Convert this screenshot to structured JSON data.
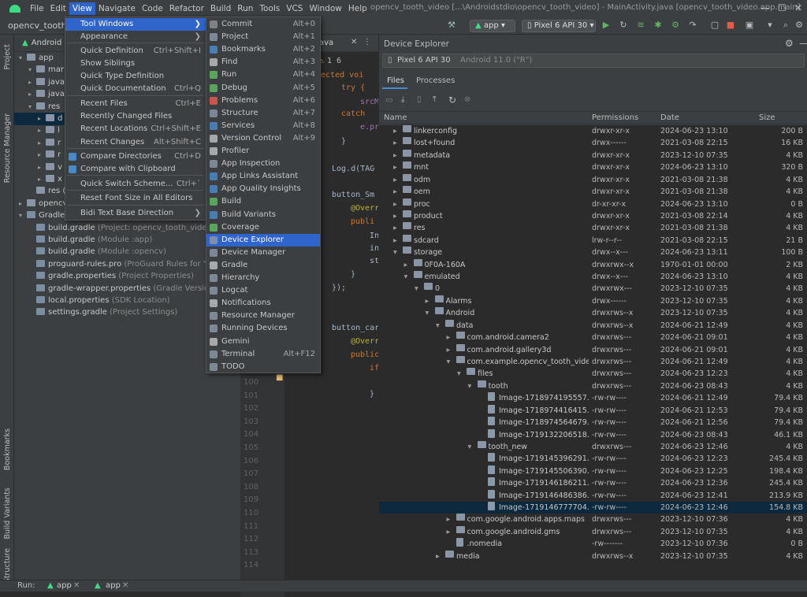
{
  "menubar": {
    "items": [
      "File",
      "Edit",
      "View",
      "Navigate",
      "Code",
      "Refactor",
      "Build",
      "Run",
      "Tools",
      "VCS",
      "Window",
      "Help"
    ],
    "active": "View",
    "window_title": "opencv_tooth_video [...\\Androidstdio\\opencv_tooth_video] - MainActivity.java [opencv_tooth_video.app.main]"
  },
  "toolbar": {
    "project_name": "opencv_tooth_v",
    "run_config": "app",
    "device": "Pixel 6 API 30"
  },
  "left_tool_windows": [
    "Project",
    "Resource Manager",
    "Bookmarks",
    "Build Variants",
    "Structure"
  ],
  "project_pane": {
    "header": "Android",
    "tree": [
      {
        "label": "app",
        "dim": ""
      },
      {
        "label": "mar",
        "dim": ""
      },
      {
        "label": "java",
        "dim": ""
      },
      {
        "label": "java",
        "dim": ""
      },
      {
        "label": "res",
        "dim": ""
      },
      {
        "label": "d",
        "dim": ""
      },
      {
        "label": "l",
        "dim": ""
      },
      {
        "label": "r",
        "dim": ""
      },
      {
        "label": "r",
        "dim": ""
      },
      {
        "label": "v",
        "dim": ""
      },
      {
        "label": "x",
        "dim": ""
      },
      {
        "label": "res (",
        "dim": ""
      },
      {
        "label": "opencv",
        "dim": ""
      },
      {
        "label": "Gradle Scripts",
        "dim": ""
      },
      {
        "label": "build.gradle",
        "dim": "(Project: opencv_tooth_video)"
      },
      {
        "label": "build.gradle",
        "dim": "(Module :app)"
      },
      {
        "label": "build.gradle",
        "dim": "(Module :opencv)"
      },
      {
        "label": "proguard-rules.pro",
        "dim": "(ProGuard Rules for \":app"
      },
      {
        "label": "gradle.properties",
        "dim": "(Project Properties)"
      },
      {
        "label": "gradle-wrapper.properties",
        "dim": "(Gradle Version)"
      },
      {
        "label": "local.properties",
        "dim": "(SDK Location)"
      },
      {
        "label": "settings.gradle",
        "dim": "(Project Settings)"
      }
    ]
  },
  "editor": {
    "tab": "ava",
    "inspections": "1  6",
    "line_numbers": [
      "100",
      "101",
      "102",
      "103",
      "104",
      "105",
      "106",
      "107",
      "108",
      "109",
      "110",
      "111",
      "112",
      "113",
      "114"
    ],
    "code_lines": [
      "otected voi",
      "try {",
      "srcM",
      "catch",
      "e.pr",
      "}",
      "Log.d(TAG",
      "button_Sm",
      "@Overr",
      "publi",
      "In",
      "in",
      "st",
      "}",
      "});",
      "button_car",
      "@Overr",
      "public",
      "if",
      "}"
    ]
  },
  "view_menu": [
    {
      "label": "Tool Windows",
      "shortcut": "",
      "submenu": true
    },
    {
      "label": "Appearance",
      "shortcut": "",
      "submenu": true
    },
    {
      "label": "Quick Definition",
      "shortcut": "Ctrl+Shift+I"
    },
    {
      "label": "Show Siblings",
      "shortcut": ""
    },
    {
      "label": "Quick Type Definition",
      "shortcut": ""
    },
    {
      "label": "Quick Documentation",
      "shortcut": "Ctrl+Q"
    },
    {
      "label": "Recent Files",
      "shortcut": "Ctrl+E"
    },
    {
      "label": "Recently Changed Files",
      "shortcut": ""
    },
    {
      "label": "Recent Locations",
      "shortcut": "Ctrl+Shift+E"
    },
    {
      "label": "Recent Changes",
      "shortcut": "Alt+Shift+C"
    },
    {
      "label": "Compare Directories",
      "shortcut": "Ctrl+D"
    },
    {
      "label": "Compare with Clipboard",
      "shortcut": ""
    },
    {
      "label": "Quick Switch Scheme...",
      "shortcut": "Ctrl+`"
    },
    {
      "label": "Reset Font Size in All Editors",
      "shortcut": ""
    },
    {
      "label": "Bidi Text Base Direction",
      "shortcut": "",
      "submenu": true
    }
  ],
  "tool_windows_menu": [
    {
      "label": "Commit",
      "shortcut": "Alt+0"
    },
    {
      "label": "Project",
      "shortcut": "Alt+1"
    },
    {
      "label": "Bookmarks",
      "shortcut": "Alt+2"
    },
    {
      "label": "Find",
      "shortcut": "Alt+3"
    },
    {
      "label": "Run",
      "shortcut": "Alt+4"
    },
    {
      "label": "Debug",
      "shortcut": "Alt+5"
    },
    {
      "label": "Problems",
      "shortcut": "Alt+6"
    },
    {
      "label": "Structure",
      "shortcut": "Alt+7"
    },
    {
      "label": "Services",
      "shortcut": "Alt+8"
    },
    {
      "label": "Version Control",
      "shortcut": "Alt+9"
    },
    {
      "label": "Profiler",
      "shortcut": ""
    },
    {
      "label": "App Inspection",
      "shortcut": ""
    },
    {
      "label": "App Links Assistant",
      "shortcut": ""
    },
    {
      "label": "App Quality Insights",
      "shortcut": ""
    },
    {
      "label": "Build",
      "shortcut": ""
    },
    {
      "label": "Build Variants",
      "shortcut": ""
    },
    {
      "label": "Coverage",
      "shortcut": ""
    },
    {
      "label": "Device Explorer",
      "shortcut": ""
    },
    {
      "label": "Device Manager",
      "shortcut": ""
    },
    {
      "label": "Gradle",
      "shortcut": ""
    },
    {
      "label": "Hierarchy",
      "shortcut": ""
    },
    {
      "label": "Logcat",
      "shortcut": ""
    },
    {
      "label": "Notifications",
      "shortcut": ""
    },
    {
      "label": "Resource Manager",
      "shortcut": ""
    },
    {
      "label": "Running Devices",
      "shortcut": ""
    },
    {
      "label": "Gemini",
      "shortcut": ""
    },
    {
      "label": "Terminal",
      "shortcut": "Alt+F12"
    },
    {
      "label": "TODO",
      "shortcut": ""
    }
  ],
  "device_explorer": {
    "title": "Device Explorer",
    "device": "Pixel 6 API 30",
    "device_detail": "Android 11.0 (\"R\")",
    "tabs": [
      "Files",
      "Processes"
    ],
    "columns": [
      "Name",
      "Permissions",
      "Date",
      "Size"
    ],
    "rows": [
      {
        "name": "linkerconfig",
        "perm": "drwxr-xr-x",
        "date": "2024-06-23 13:10",
        "size": "200 B",
        "depth": 0,
        "type": "folder",
        "exp": "closed"
      },
      {
        "name": "lost+found",
        "perm": "drwx------",
        "date": "2021-03-08 22:15",
        "size": "16 KB",
        "depth": 0,
        "type": "folder",
        "exp": "closed"
      },
      {
        "name": "metadata",
        "perm": "drwxr-xr-x",
        "date": "2023-12-10 07:35",
        "size": "4 KB",
        "depth": 0,
        "type": "folder",
        "exp": "closed"
      },
      {
        "name": "mnt",
        "perm": "drwxr-xr-x",
        "date": "2024-06-23 13:10",
        "size": "320 B",
        "depth": 0,
        "type": "folder",
        "exp": "closed"
      },
      {
        "name": "odm",
        "perm": "drwxr-xr-x",
        "date": "2021-03-08 21:38",
        "size": "4 KB",
        "depth": 0,
        "type": "folder",
        "exp": "closed"
      },
      {
        "name": "oem",
        "perm": "drwxr-xr-x",
        "date": "2021-03-08 21:38",
        "size": "4 KB",
        "depth": 0,
        "type": "folder",
        "exp": "closed"
      },
      {
        "name": "proc",
        "perm": "dr-xr-xr-x",
        "date": "2024-06-23 13:10",
        "size": "0 B",
        "depth": 0,
        "type": "folder",
        "exp": "closed"
      },
      {
        "name": "product",
        "perm": "drwxr-xr-x",
        "date": "2021-03-08 22:14",
        "size": "4 KB",
        "depth": 0,
        "type": "folder",
        "exp": "closed"
      },
      {
        "name": "res",
        "perm": "drwxr-xr-x",
        "date": "2021-03-08 21:38",
        "size": "4 KB",
        "depth": 0,
        "type": "folder",
        "exp": "closed"
      },
      {
        "name": "sdcard",
        "perm": "lrw-r--r--",
        "date": "2021-03-08 22:15",
        "size": "21 B",
        "depth": 0,
        "type": "folder",
        "exp": "closed"
      },
      {
        "name": "storage",
        "perm": "drwx--x---",
        "date": "2024-06-23 13:11",
        "size": "100 B",
        "depth": 0,
        "type": "folder",
        "exp": "open"
      },
      {
        "name": "0F0A-160A",
        "perm": "drwxrwx--x",
        "date": "1970-01-01 00:00",
        "size": "2 KB",
        "depth": 1,
        "type": "folder",
        "exp": "closed"
      },
      {
        "name": "emulated",
        "perm": "drwx--x---",
        "date": "2024-06-23 13:10",
        "size": "4 KB",
        "depth": 1,
        "type": "folder",
        "exp": "open"
      },
      {
        "name": "0",
        "perm": "drwxrwx---",
        "date": "2023-12-10 07:35",
        "size": "4 KB",
        "depth": 2,
        "type": "folder",
        "exp": "open"
      },
      {
        "name": "Alarms",
        "perm": "drwx------",
        "date": "2023-12-10 07:35",
        "size": "4 KB",
        "depth": 3,
        "type": "folder",
        "exp": "closed"
      },
      {
        "name": "Android",
        "perm": "drwxrws--x",
        "date": "2023-12-10 07:35",
        "size": "4 KB",
        "depth": 3,
        "type": "folder",
        "exp": "open"
      },
      {
        "name": "data",
        "perm": "drwxrws--x",
        "date": "2024-06-21 12:49",
        "size": "4 KB",
        "depth": 4,
        "type": "folder",
        "exp": "open"
      },
      {
        "name": "com.android.camera2",
        "perm": "drwxrws---",
        "date": "2024-06-21 09:01",
        "size": "4 KB",
        "depth": 5,
        "type": "folder",
        "exp": "closed"
      },
      {
        "name": "com.android.gallery3d",
        "perm": "drwxrws---",
        "date": "2024-06-21 09:01",
        "size": "4 KB",
        "depth": 5,
        "type": "folder",
        "exp": "closed"
      },
      {
        "name": "com.example.opencv_tooth_vide",
        "perm": "drwxrws---",
        "date": "2024-06-21 12:49",
        "size": "4 KB",
        "depth": 5,
        "type": "folder",
        "exp": "open"
      },
      {
        "name": "files",
        "perm": "drwxrws---",
        "date": "2024-06-23 12:23",
        "size": "4 KB",
        "depth": 6,
        "type": "folder",
        "exp": "open"
      },
      {
        "name": "tooth",
        "perm": "drwxrws---",
        "date": "2024-06-23 08:43",
        "size": "4 KB",
        "depth": 7,
        "type": "folder",
        "exp": "open"
      },
      {
        "name": "Image-1718974195557.j",
        "perm": "-rw-rw----",
        "date": "2024-06-21 12:49",
        "size": "79.4 KB",
        "depth": 8,
        "type": "file",
        "exp": "none"
      },
      {
        "name": "Image-1718974416415.j",
        "perm": "-rw-rw----",
        "date": "2024-06-21 12:53",
        "size": "79.4 KB",
        "depth": 8,
        "type": "file",
        "exp": "none"
      },
      {
        "name": "Image-1718974564679.j",
        "perm": "-rw-rw----",
        "date": "2024-06-21 12:56",
        "size": "79.4 KB",
        "depth": 8,
        "type": "file",
        "exp": "none"
      },
      {
        "name": "Image-1719132206518.j",
        "perm": "-rw-rw----",
        "date": "2024-06-23 08:43",
        "size": "46.1 KB",
        "depth": 8,
        "type": "file",
        "exp": "none"
      },
      {
        "name": "tooth_new",
        "perm": "drwxrws---",
        "date": "2024-06-23 12:46",
        "size": "4 KB",
        "depth": 7,
        "type": "folder",
        "exp": "open"
      },
      {
        "name": "Image-1719145396291.j",
        "perm": "-rw-rw----",
        "date": "2024-06-23 12:23",
        "size": "245.4 KB",
        "depth": 8,
        "type": "file",
        "exp": "none"
      },
      {
        "name": "Image-1719145506390.j",
        "perm": "-rw-rw----",
        "date": "2024-06-23 12:25",
        "size": "198.4 KB",
        "depth": 8,
        "type": "file",
        "exp": "none"
      },
      {
        "name": "Image-1719146186211.j",
        "perm": "-rw-rw----",
        "date": "2024-06-23 12:36",
        "size": "245.4 KB",
        "depth": 8,
        "type": "file",
        "exp": "none"
      },
      {
        "name": "Image-1719146486386.j",
        "perm": "-rw-rw----",
        "date": "2024-06-23 12:41",
        "size": "213.9 KB",
        "depth": 8,
        "type": "file",
        "exp": "none"
      },
      {
        "name": "Image-1719146777704.j",
        "perm": "-rw-rw----",
        "date": "2024-06-23 12:46",
        "size": "154.8 KB",
        "depth": 8,
        "type": "file",
        "exp": "none",
        "selected": true
      },
      {
        "name": "com.google.android.apps.maps",
        "perm": "drwxrws---",
        "date": "2023-12-10 07:36",
        "size": "4 KB",
        "depth": 5,
        "type": "folder",
        "exp": "closed"
      },
      {
        "name": "com.google.android.gms",
        "perm": "drwxrws---",
        "date": "2023-12-10 07:35",
        "size": "4 KB",
        "depth": 5,
        "type": "folder",
        "exp": "closed"
      },
      {
        "name": ".nomedia",
        "perm": "-rw-------",
        "date": "2023-12-10 07:36",
        "size": "0 B",
        "depth": 5,
        "type": "file",
        "exp": "none"
      },
      {
        "name": "media",
        "perm": "drwxrws--x",
        "date": "2023-12-10 07:35",
        "size": "4 KB",
        "depth": 4,
        "type": "folder",
        "exp": "closed"
      }
    ]
  },
  "bottom_bar": {
    "run_label": "Run:",
    "tabs": [
      "app",
      "app"
    ]
  },
  "colors": {
    "accent": "#2f65ca",
    "selection": "#0d293e",
    "android_green": "#3ddc84"
  }
}
